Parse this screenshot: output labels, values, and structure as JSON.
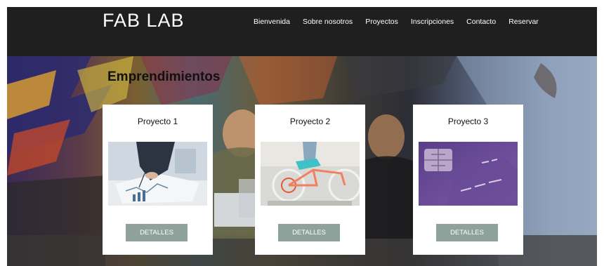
{
  "header": {
    "logo": "FAB LAB",
    "nav": [
      "Bienvenida",
      "Sobre nosotros",
      "Proyectos",
      "Inscripciones",
      "Contacto",
      "Reservar"
    ]
  },
  "section": {
    "title": "Emprendimientos"
  },
  "cards": [
    {
      "title": "Proyecto 1",
      "button": "DETALLES",
      "image": "business-charts-photo"
    },
    {
      "title": "Proyecto 2",
      "button": "DETALLES",
      "image": "bicycle-photo"
    },
    {
      "title": "Proyecto 3",
      "button": "DETALLES",
      "image": "credit-card-chip-photo"
    }
  ],
  "colors": {
    "header_bg": "#1f1f1f",
    "button_bg": "#8fa19b",
    "card_bg": "#ffffff"
  }
}
